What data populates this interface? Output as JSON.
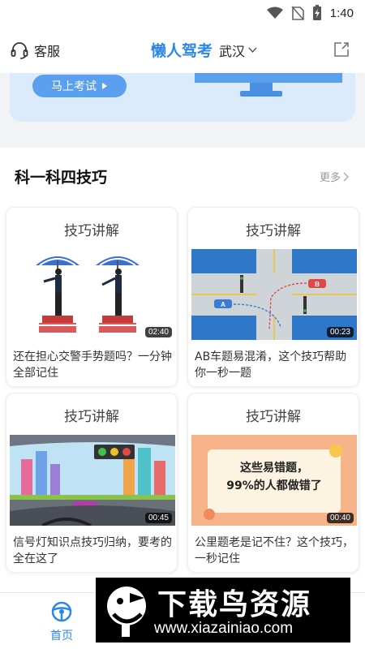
{
  "status_bar": {
    "time": "1:40"
  },
  "header": {
    "customer_service": "客服",
    "app_name": "懒人驾考",
    "city": "武汉"
  },
  "banner": {
    "button_label": "马上考试"
  },
  "section": {
    "title": "科一科四技巧",
    "more": "更多"
  },
  "cards": [
    {
      "title": "技巧讲解",
      "duration": "02:40",
      "desc": "还在担心交警手势题吗？一分钟全部记住"
    },
    {
      "title": "技巧讲解",
      "duration": "00:23",
      "desc": "AB车题易混淆，这个技巧帮助你一秒一题"
    },
    {
      "title": "技巧讲解",
      "duration": "00:45",
      "desc": "信号灯知识点技巧归纳，要考的全在这了"
    },
    {
      "title": "技巧讲解",
      "duration": "00:40",
      "desc": "公里题老是记不住？这个技巧，一秒记住"
    }
  ],
  "thumbnails": {
    "car_a": "A",
    "car_b": "B",
    "poster_line1": "这些易错题，",
    "poster_line2": "99%的人都做错了"
  },
  "tab_bar": {
    "home": "首页"
  },
  "watermark": {
    "text": "下载鸟资源",
    "url": "www.xiazainiao.com"
  },
  "colors": {
    "brand": "#2b86e8",
    "accent_button": "#5aa0ee"
  }
}
